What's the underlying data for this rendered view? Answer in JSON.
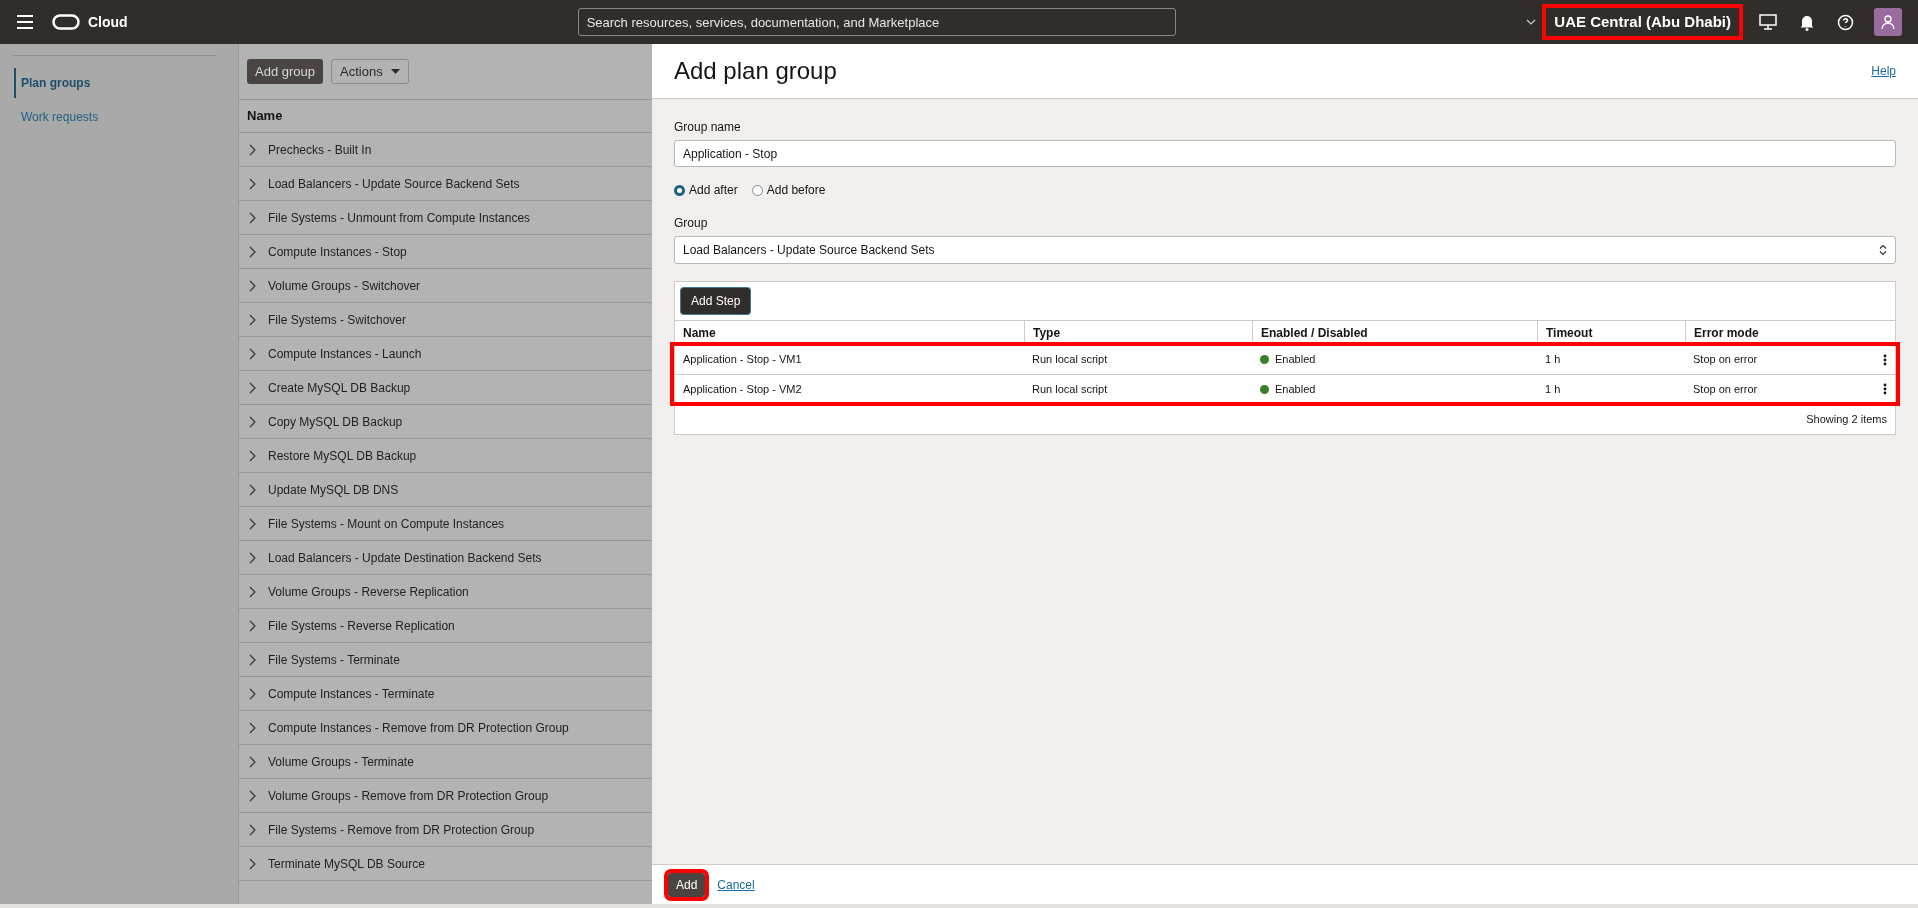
{
  "header": {
    "logo_text": "Cloud",
    "search": {
      "placeholder": "Search resources, services, documentation, and Marketplace"
    },
    "region": {
      "label": "UAE Central (Abu Dhabi)",
      "highlighted": true
    }
  },
  "sidebar": {
    "items": [
      {
        "label": "Plan groups",
        "selected": true
      },
      {
        "label": "Work requests",
        "selected": false
      }
    ]
  },
  "plan_groups": {
    "toolbar": [
      "Add group",
      "Actions"
    ],
    "column": "Name",
    "rows": [
      "Prechecks - Built In",
      "Load Balancers - Update Source Backend Sets",
      "File Systems - Unmount from Compute Instances",
      "Compute Instances - Stop",
      "Volume Groups - Switchover",
      "File Systems - Switchover",
      "Compute Instances - Launch",
      "Create MySQL DB Backup",
      "Copy MySQL DB Backup",
      "Restore MySQL DB Backup",
      "Update MySQL DB DNS",
      "File Systems - Mount on Compute Instances",
      "Load Balancers - Update Destination Backend Sets",
      "Volume Groups - Reverse Replication",
      "File Systems - Reverse Replication",
      "File Systems - Terminate",
      "Compute Instances - Terminate",
      "Compute Instances - Remove from DR Protection Group",
      "Volume Groups - Terminate",
      "Volume Groups - Remove from DR Protection Group",
      "File Systems - Remove from DR Protection Group",
      "Terminate MySQL DB Source"
    ]
  },
  "drawer": {
    "title": "Add plan group",
    "help": "Help",
    "group_name": {
      "label": "Group name",
      "value": "Application - Stop"
    },
    "position": [
      {
        "label": "Add after",
        "selected": true
      },
      {
        "label": "Add before",
        "selected": false
      }
    ],
    "group": {
      "label": "Group",
      "value": "Load Balancers - Update Source Backend Sets"
    },
    "steps": {
      "button": "Add Step",
      "columns": [
        "Name",
        "Type",
        "Enabled / Disabled",
        "Timeout",
        "Error mode"
      ],
      "rows_highlighted": true,
      "rows": [
        {
          "name": "Application - Stop - VM1",
          "type": "Run local script",
          "enabled": "Enabled",
          "color": "#3a7d2a",
          "timeout": "1 h",
          "error_mode": "Stop on error"
        },
        {
          "name": "Application - Stop - VM2",
          "type": "Run local script",
          "enabled": "Enabled",
          "color": "#3a7d2a",
          "timeout": "1 h",
          "error_mode": "Stop on error"
        }
      ],
      "footer": "Showing 2 items"
    },
    "footer": {
      "add": {
        "label": "Add",
        "highlighted": true
      },
      "cancel": "Cancel"
    }
  }
}
